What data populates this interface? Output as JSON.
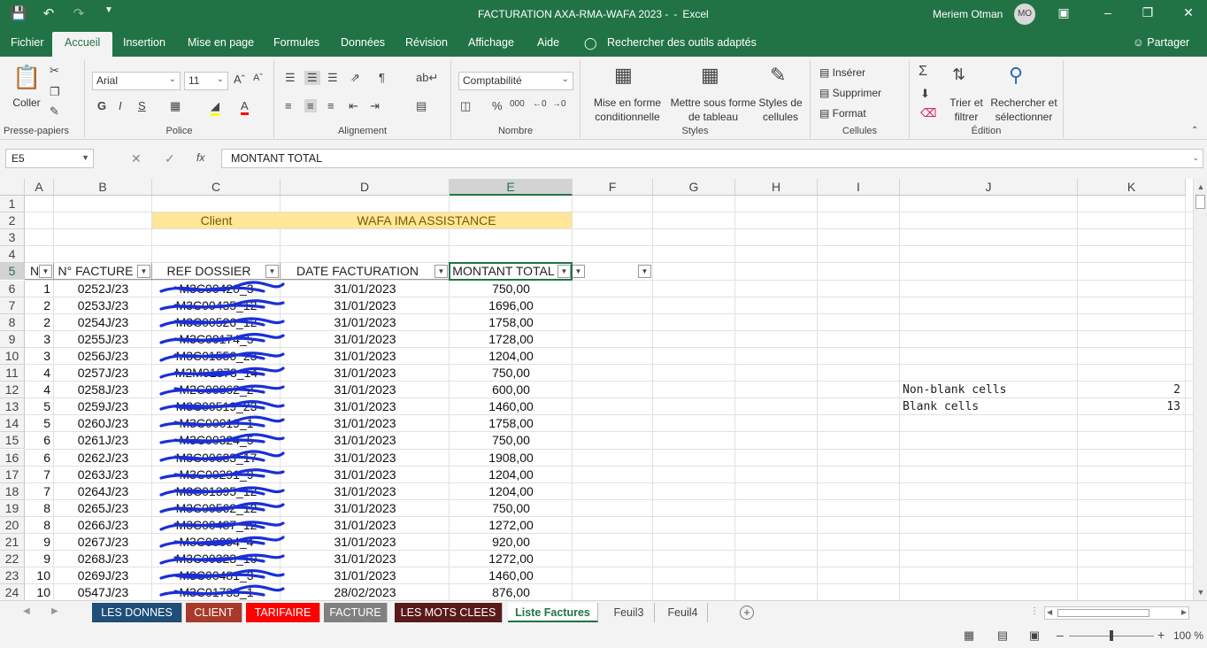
{
  "window": {
    "title": "FACTURATION AXA-RMA-WAFA 2023 -",
    "separator": "-",
    "app": "Excel",
    "user": "Meriem Otman",
    "user_initials": "MO"
  },
  "ribbon_tabs": [
    "Fichier",
    "Accueil",
    "Insertion",
    "Mise en page",
    "Formules",
    "Données",
    "Révision",
    "Affichage",
    "Aide"
  ],
  "active_tab": "Accueil",
  "search_label": "Rechercher des outils adaptés",
  "share_label": "Partager",
  "ribbon": {
    "clipboard": {
      "paste": "Coller",
      "label": "Presse-papiers"
    },
    "font": {
      "name": "Arial",
      "size": "11",
      "bold": "G",
      "italic": "I",
      "underline": "S",
      "label": "Police"
    },
    "alignment": {
      "label": "Alignement"
    },
    "number": {
      "format": "Comptabilité",
      "percent": "%",
      "thousands": "000",
      "label": "Nombre"
    },
    "styles": {
      "conditional_1": "Mise en forme",
      "conditional_2": "conditionnelle",
      "table_1": "Mettre sous forme",
      "table_2": "de tableau",
      "cell_1": "Styles de",
      "cell_2": "cellules",
      "label": "Styles"
    },
    "cells": {
      "insert": "Insérer",
      "delete": "Supprimer",
      "format": "Format",
      "label": "Cellules"
    },
    "editing": {
      "sort_1": "Trier et",
      "sort_2": "filtrer",
      "find_1": "Rechercher et",
      "find_2": "sélectionner",
      "label": "Édition"
    }
  },
  "formula_bar": {
    "name_box": "E5",
    "fx": "fx",
    "formula": "MONTANT TOTAL"
  },
  "columns": [
    "A",
    "B",
    "C",
    "D",
    "E",
    "F",
    "G",
    "H",
    "I",
    "J",
    "K"
  ],
  "selected_column": "E",
  "selected_row": "5",
  "row_numbers": [
    "1",
    "2",
    "3",
    "4",
    "5",
    "6",
    "7",
    "8",
    "9",
    "10",
    "11",
    "12",
    "13",
    "14",
    "15",
    "16",
    "17",
    "18",
    "19",
    "20",
    "21",
    "22",
    "23",
    "24"
  ],
  "row2": {
    "client_label": "Client",
    "client_value": "WAFA IMA ASSISTANCE"
  },
  "table_headers": [
    "N",
    "N° FACTURE",
    "REF DOSSIER",
    "DATE FACTURATION",
    "MONTANT TOTAL"
  ],
  "table_rows": [
    {
      "n": "1",
      "facture": "0252J/23",
      "ref": "M3C00420_3",
      "date": "31/01/2023",
      "montant": "750,00"
    },
    {
      "n": "2",
      "facture": "0253J/23",
      "ref": "M3C00435_12",
      "date": "31/01/2023",
      "montant": "1696,00"
    },
    {
      "n": "2",
      "facture": "0254J/23",
      "ref": "M3C00526_12",
      "date": "31/01/2023",
      "montant": "1758,00"
    },
    {
      "n": "3",
      "facture": "0255J/23",
      "ref": "M3C00174_5",
      "date": "31/01/2023",
      "montant": "1728,00"
    },
    {
      "n": "3",
      "facture": "0256J/23",
      "ref": "M3C01556_23",
      "date": "31/01/2023",
      "montant": "1204,00"
    },
    {
      "n": "4",
      "facture": "0257J/23",
      "ref": "M2M01873_14",
      "date": "31/01/2023",
      "montant": "750,00"
    },
    {
      "n": "4",
      "facture": "0258J/23",
      "ref": "M2C00862_2",
      "date": "31/01/2023",
      "montant": "600,00"
    },
    {
      "n": "5",
      "facture": "0259J/23",
      "ref": "M3C00519_23",
      "date": "31/01/2023",
      "montant": "1460,00"
    },
    {
      "n": "5",
      "facture": "0260J/23",
      "ref": "M3C00019_1",
      "date": "31/01/2023",
      "montant": "1758,00"
    },
    {
      "n": "6",
      "facture": "0261J/23",
      "ref": "M3C00324_5",
      "date": "31/01/2023",
      "montant": "750,00"
    },
    {
      "n": "6",
      "facture": "0262J/23",
      "ref": "M3C00633_17",
      "date": "31/01/2023",
      "montant": "1908,00"
    },
    {
      "n": "7",
      "facture": "0263J/23",
      "ref": "M3C00291_9",
      "date": "31/01/2023",
      "montant": "1204,00"
    },
    {
      "n": "7",
      "facture": "0264J/23",
      "ref": "M3C01395_12",
      "date": "31/01/2023",
      "montant": "1204,00"
    },
    {
      "n": "8",
      "facture": "0265J/23",
      "ref": "M3C00562_12",
      "date": "31/01/2023",
      "montant": "750,00"
    },
    {
      "n": "8",
      "facture": "0266J/23",
      "ref": "M3C00487_12",
      "date": "31/01/2023",
      "montant": "1272,00"
    },
    {
      "n": "9",
      "facture": "0267J/23",
      "ref": "M3C00094_4",
      "date": "31/01/2023",
      "montant": "920,00"
    },
    {
      "n": "9",
      "facture": "0268J/23",
      "ref": "M3C00323_10",
      "date": "31/01/2023",
      "montant": "1272,00"
    },
    {
      "n": "10",
      "facture": "0269J/23",
      "ref": "M3C00481_3",
      "date": "31/01/2023",
      "montant": "1460,00"
    },
    {
      "n": "10",
      "facture": "0547J/23",
      "ref": "M3C01733_1",
      "date": "28/02/2023",
      "montant": "876,00"
    }
  ],
  "side_stats": [
    {
      "label": "Non-blank cells",
      "value": "2"
    },
    {
      "label": "Blank cells",
      "value": "13"
    }
  ],
  "sheet_tabs": [
    {
      "name": "LES DONNES",
      "color": "#1f4e79"
    },
    {
      "name": "CLIENT",
      "color": "#a93a2b"
    },
    {
      "name": "TARIFAIRE",
      "color": "#ff0000"
    },
    {
      "name": "FACTURE",
      "color": "#808080"
    },
    {
      "name": "LES MOTS CLEES",
      "color": "#5a1a1a"
    },
    {
      "name": "Liste Factures",
      "color": ""
    },
    {
      "name": "Feuil3",
      "color": ""
    },
    {
      "name": "Feuil4",
      "color": ""
    }
  ],
  "active_sheet": "Liste Factures",
  "status": {
    "zoom": "100 %"
  },
  "colors": {
    "accent": "#217346",
    "yellow_fill": "#ffe699",
    "redaction": "#1a2fd6"
  }
}
